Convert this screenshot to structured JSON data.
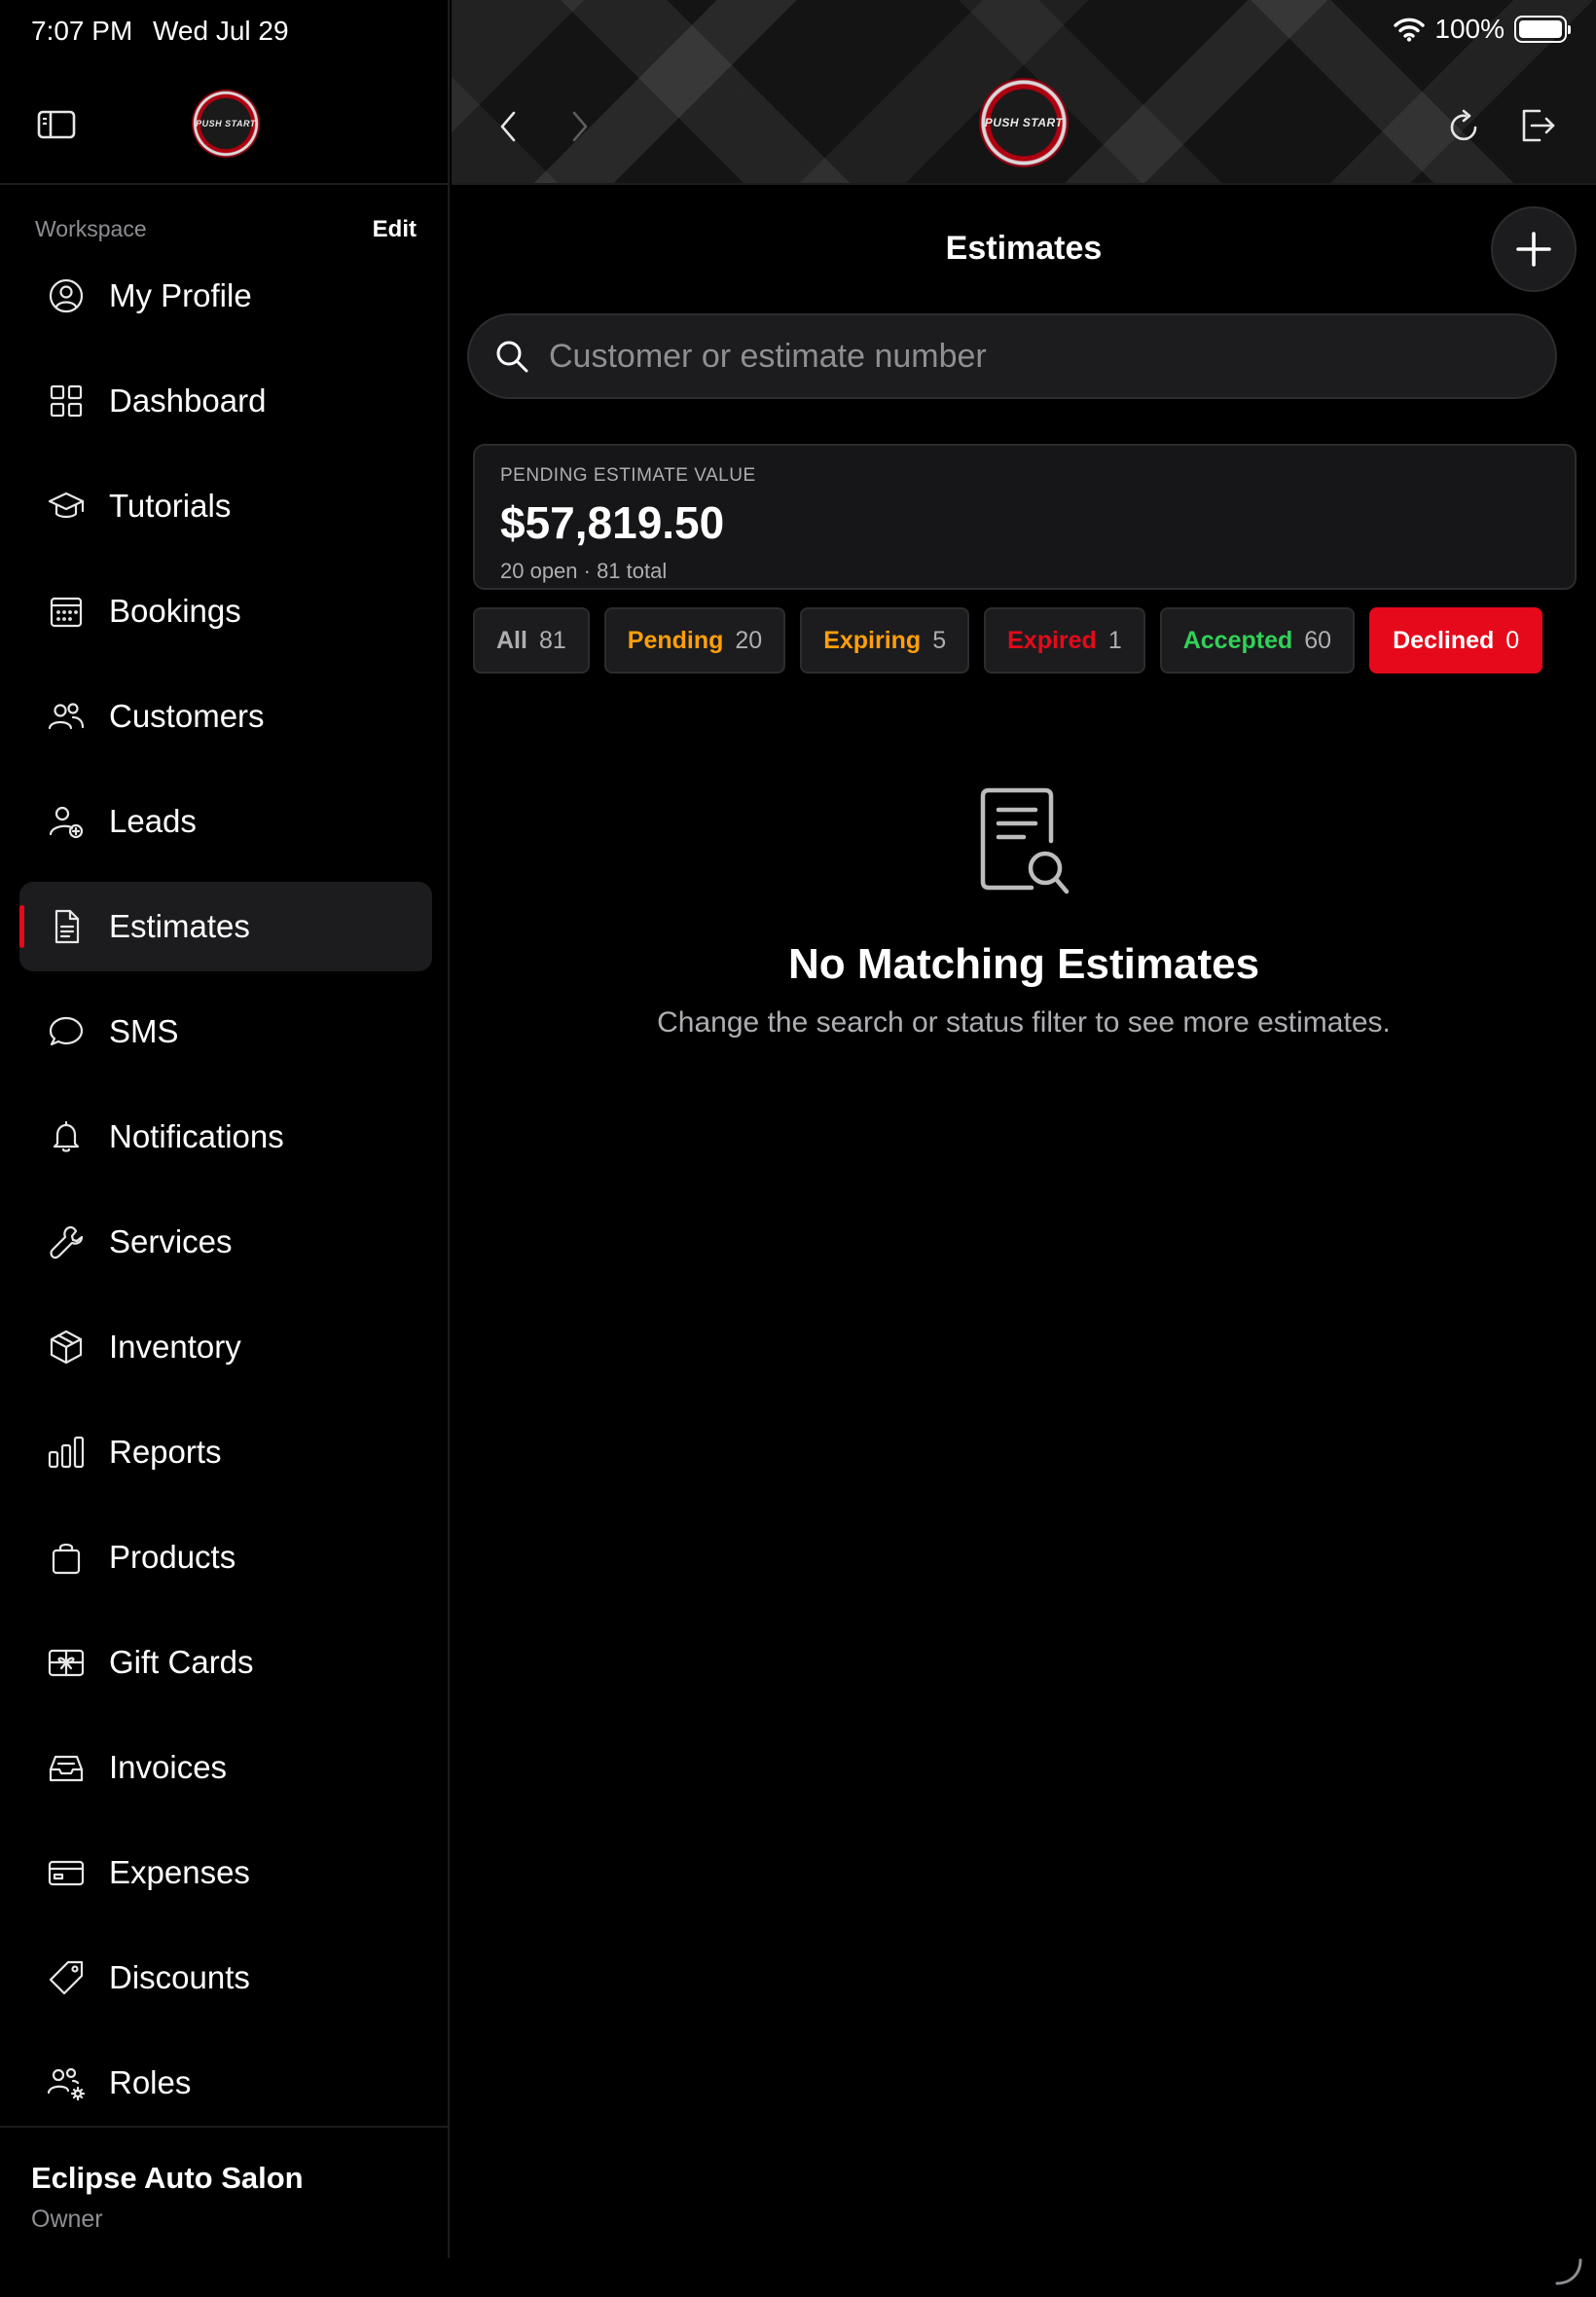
{
  "status_bar": {
    "time": "7:07 PM",
    "date": "Wed Jul 29",
    "battery": "100%"
  },
  "brand": {
    "logo_text": "PUSH START"
  },
  "sidebar": {
    "workspace_label": "Workspace",
    "edit_label": "Edit",
    "items": [
      {
        "label": "My Profile",
        "icon": "profile-icon"
      },
      {
        "label": "Dashboard",
        "icon": "dashboard-icon"
      },
      {
        "label": "Tutorials",
        "icon": "graduation-cap-icon"
      },
      {
        "label": "Bookings",
        "icon": "calendar-icon"
      },
      {
        "label": "Customers",
        "icon": "people-icon"
      },
      {
        "label": "Leads",
        "icon": "add-person-icon"
      },
      {
        "label": "Estimates",
        "icon": "document-icon",
        "active": true
      },
      {
        "label": "SMS",
        "icon": "chat-bubble-icon"
      },
      {
        "label": "Notifications",
        "icon": "bell-icon"
      },
      {
        "label": "Services",
        "icon": "wrench-icon"
      },
      {
        "label": "Inventory",
        "icon": "box-icon"
      },
      {
        "label": "Reports",
        "icon": "bar-chart-icon"
      },
      {
        "label": "Products",
        "icon": "shopping-bag-icon"
      },
      {
        "label": "Gift Cards",
        "icon": "gift-card-icon"
      },
      {
        "label": "Invoices",
        "icon": "inbox-icon"
      },
      {
        "label": "Expenses",
        "icon": "credit-card-icon"
      },
      {
        "label": "Discounts",
        "icon": "tag-icon"
      },
      {
        "label": "Roles",
        "icon": "people-gear-icon"
      }
    ],
    "footer": {
      "business_name": "Eclipse Auto Salon",
      "role": "Owner"
    }
  },
  "main": {
    "title": "Estimates",
    "search": {
      "placeholder": "Customer or estimate number",
      "value": ""
    },
    "summary": {
      "label": "PENDING ESTIMATE VALUE",
      "value": "$57,819.50",
      "sub": "20 open · 81 total"
    },
    "filters": [
      {
        "key": "all",
        "label": "All",
        "count": "81"
      },
      {
        "key": "pending",
        "label": "Pending",
        "count": "20"
      },
      {
        "key": "expiring",
        "label": "Expiring",
        "count": "5"
      },
      {
        "key": "expired",
        "label": "Expired",
        "count": "1"
      },
      {
        "key": "accepted",
        "label": "Accepted",
        "count": "60"
      },
      {
        "key": "declined",
        "label": "Declined",
        "count": "0",
        "selected": true
      }
    ],
    "empty_state": {
      "title": "No Matching Estimates",
      "subtitle": "Change the search or status filter to see more estimates."
    }
  },
  "colors": {
    "accent": "#e5091b",
    "pending": "#ff9f0a",
    "accepted": "#30d158",
    "surface": "#1c1c1e"
  }
}
